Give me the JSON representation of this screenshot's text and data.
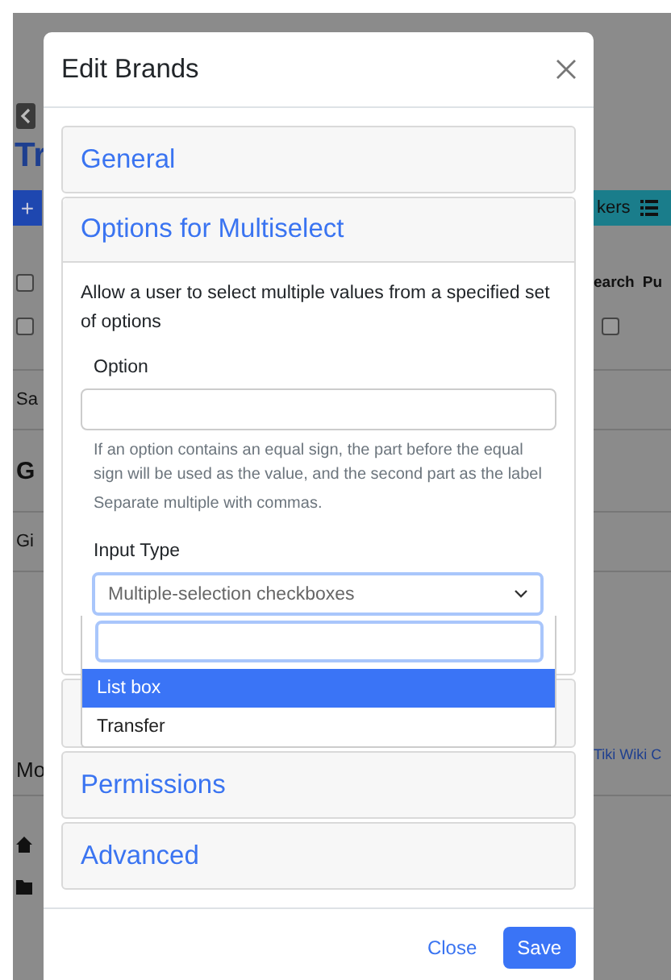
{
  "background": {
    "page_title": "Tr",
    "add_button": "+",
    "toolbar_fragment": "kers",
    "table_headers": [
      "earch",
      "Pu"
    ],
    "checkboxes": [
      {
        "checked": false
      },
      {
        "checked": false
      },
      {
        "checked": false
      }
    ],
    "rows": [
      "Sa",
      "G",
      "Gi"
    ],
    "menu_fragment": "Mo",
    "footer_link": "Tiki Wiki C"
  },
  "modal": {
    "title": "Edit Brands",
    "sections": [
      {
        "title": "General",
        "expanded": false
      },
      {
        "title": "Options for Multiselect",
        "expanded": true,
        "description": "Allow a user to select multiple values from a specified set of options",
        "option_field": {
          "label": "Option",
          "help": "If an option contains an equal sign, the part before the equal sign will be used as the value, and the second part as the label",
          "note": "Separate multiple with commas."
        },
        "input_type": {
          "label": "Input Type",
          "value": "Multiple-selection checkboxes",
          "options": [
            {
              "label": "List box",
              "selected": true
            },
            {
              "label": "Transfer",
              "selected": false
            }
          ]
        }
      },
      {
        "title": "Permissions",
        "expanded": false
      },
      {
        "title": "Advanced",
        "expanded": false
      }
    ],
    "buttons": [
      {
        "label": "Close",
        "kind": "link"
      },
      {
        "label": "Save",
        "kind": "primary"
      }
    ]
  }
}
